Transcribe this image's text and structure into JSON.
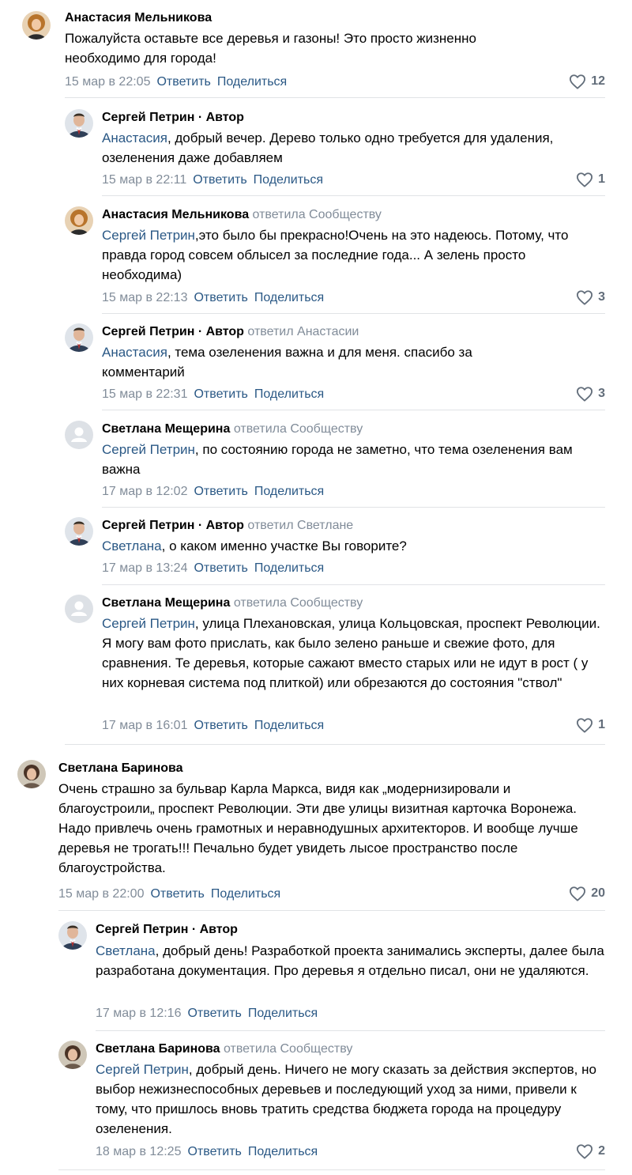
{
  "ui": {
    "reply_label": "Ответить",
    "share_label": "Поделиться"
  },
  "comments": [
    {
      "author": "Анастасия Мельникова",
      "author_tag": "",
      "replied_to": "",
      "mention": "",
      "body": "Пожалуйста оставьте все деревья и газоны! Это просто жизненно необходимо для города!",
      "time": "15 мар в 22:05",
      "likes": "12"
    },
    {
      "author": "Сергей Петрин",
      "author_tag": " · Автор",
      "replied_to": "",
      "mention": "Анастасия",
      "body": ", добрый вечер. Дерево только одно требуется для удаления, озеленения даже добавляем",
      "time": "15 мар в 22:11",
      "likes": "1"
    },
    {
      "author": "Анастасия Мельникова",
      "author_tag": "",
      "replied_to": "ответила Сообществу",
      "mention": "Сергей Петрин",
      "body": ",это было бы прекрасно!Очень на это надеюсь. Потому, что правда город совсем облысел за последние года... А зелень просто необходима)",
      "time": "15 мар в 22:13",
      "likes": "3"
    },
    {
      "author": "Сергей Петрин",
      "author_tag": " · Автор",
      "replied_to": "ответил Анастасии",
      "mention": "Анастасия",
      "body": ", тема озеленения важна и для меня. спасибо за комментарий",
      "time": "15 мар в 22:31",
      "likes": "3"
    },
    {
      "author": "Светлана Мещерина",
      "author_tag": "",
      "replied_to": "ответила Сообществу",
      "mention": "Сергей Петрин",
      "body": ", по состоянию города не заметно, что тема озеленения вам важна",
      "time": "17 мар в 12:02",
      "likes": ""
    },
    {
      "author": "Сергей Петрин",
      "author_tag": " · Автор",
      "replied_to": "ответил Светлане",
      "mention": "Светлана",
      "body": ", о каком именно участке Вы говорите?",
      "time": "17 мар в 13:24",
      "likes": ""
    },
    {
      "author": "Светлана Мещерина",
      "author_tag": "",
      "replied_to": "ответила Сообществу",
      "mention": "Сергей Петрин",
      "body": ", улица Плехановская, улица Кольцовская, проспект Революции. Я могу вам фото прислать, как было зелено раньше и свежие фото, для сравнения. Те деревья, которые сажают вместо старых или не идут в рост ( у них корневая система под плиткой) или обрезаются до состояния \"ствол\"",
      "time": "17 мар в 16:01",
      "likes": "1"
    },
    {
      "author": "Светлана Баринова",
      "author_tag": "",
      "replied_to": "",
      "mention": "",
      "body": "Очень страшно за бульвар Карла Маркса, видя как „модернизировали и благоустроили„ проспект Революции. Эти две улицы визитная карточка Воронежа. Надо привлечь очень грамотных и неравнодушных архитекторов. И вообще лучше деревья не трогать!!! Печально будет увидеть лысое пространство после благоустройства.",
      "time": "15 мар в 22:00",
      "likes": "20"
    },
    {
      "author": "Сергей Петрин",
      "author_tag": " · Автор",
      "replied_to": "",
      "mention": "Светлана",
      "body": ", добрый день! Разработкой проекта занимались эксперты, далее была разработана документация. Про деревья я отдельно писал, они не удаляются.",
      "time": "17 мар в 12:16",
      "likes": ""
    },
    {
      "author": "Светлана Баринова",
      "author_tag": "",
      "replied_to": "ответила Сообществу",
      "mention": "Сергей Петрин",
      "body": ", добрый день. Ничего не могу сказать за действия экспертов, но выбор нежизнеспособных деревьев и последующий уход за ними, привели к тому, что пришлось вновь тратить средства бюджета города на процедуру озеленения.",
      "time": "18 мар в 12:25",
      "likes": "2"
    }
  ]
}
